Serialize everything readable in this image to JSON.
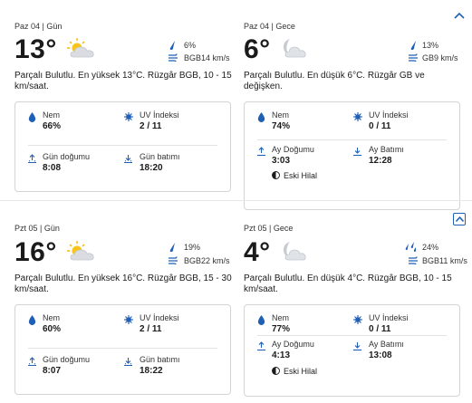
{
  "days": [
    {
      "day": {
        "header": "Paz 04 | Gün",
        "temp": "13°",
        "icon": "partly-cloudy-day-icon",
        "precip": "6%",
        "wind": "BGB14 km/s",
        "desc": "Parçalı Bulutlu. En yüksek 13°C. Rüzgâr BGB, 10 - 15 km/saat.",
        "stats": {
          "humidity_label": "Nem",
          "humidity": "66%",
          "uv_label": "UV İndeksi",
          "uv": "2 / 11",
          "rise_label": "Gün doğumu",
          "rise": "8:08",
          "set_label": "Gün batımı",
          "set": "18:20"
        }
      },
      "night": {
        "header": "Paz 04 | Gece",
        "temp": "6°",
        "icon": "partly-cloudy-night-icon",
        "precip": "13%",
        "wind": "GB9 km/s",
        "desc": "Parçalı Bulutlu. En düşük 6°C. Rüzgâr GB ve değişken.",
        "stats": {
          "humidity_label": "Nem",
          "humidity": "74%",
          "uv_label": "UV İndeksi",
          "uv": "0 / 11",
          "rise_label": "Ay Doğumu",
          "rise": "3:03",
          "set_label": "Ay Batımı",
          "set": "12:28",
          "moon_phase": "Eski Hilal"
        }
      }
    },
    {
      "day": {
        "header": "Pzt 05 | Gün",
        "temp": "16°",
        "icon": "partly-cloudy-day-icon",
        "precip": "19%",
        "wind": "BGB22 km/s",
        "desc": "Parçalı Bulutlu. En yüksek 16°C. Rüzgâr BGB, 15 - 30 km/saat.",
        "stats": {
          "humidity_label": "Nem",
          "humidity": "60%",
          "uv_label": "UV İndeksi",
          "uv": "2 / 11",
          "rise_label": "Gün doğumu",
          "rise": "8:07",
          "set_label": "Gün batımı",
          "set": "18:22"
        }
      },
      "night": {
        "header": "Pzt 05 | Gece",
        "temp": "4°",
        "icon": "partly-cloudy-night-icon",
        "precip": "24%",
        "wind": "BGB11 km/s",
        "desc": "Parçalı Bulutlu. En düşük 4°C. Rüzgâr BGB, 10 - 15 km/saat.",
        "stats": {
          "humidity_label": "Nem",
          "humidity": "77%",
          "uv_label": "UV İndeksi",
          "uv": "0 / 11",
          "rise_label": "Ay Doğumu",
          "rise": "4:13",
          "set_label": "Ay Batımı",
          "set": "13:08",
          "moon_phase": "Eski Hilal"
        }
      }
    }
  ],
  "colors": {
    "accent": "#1f5fb5",
    "border": "#d4d4d4"
  }
}
